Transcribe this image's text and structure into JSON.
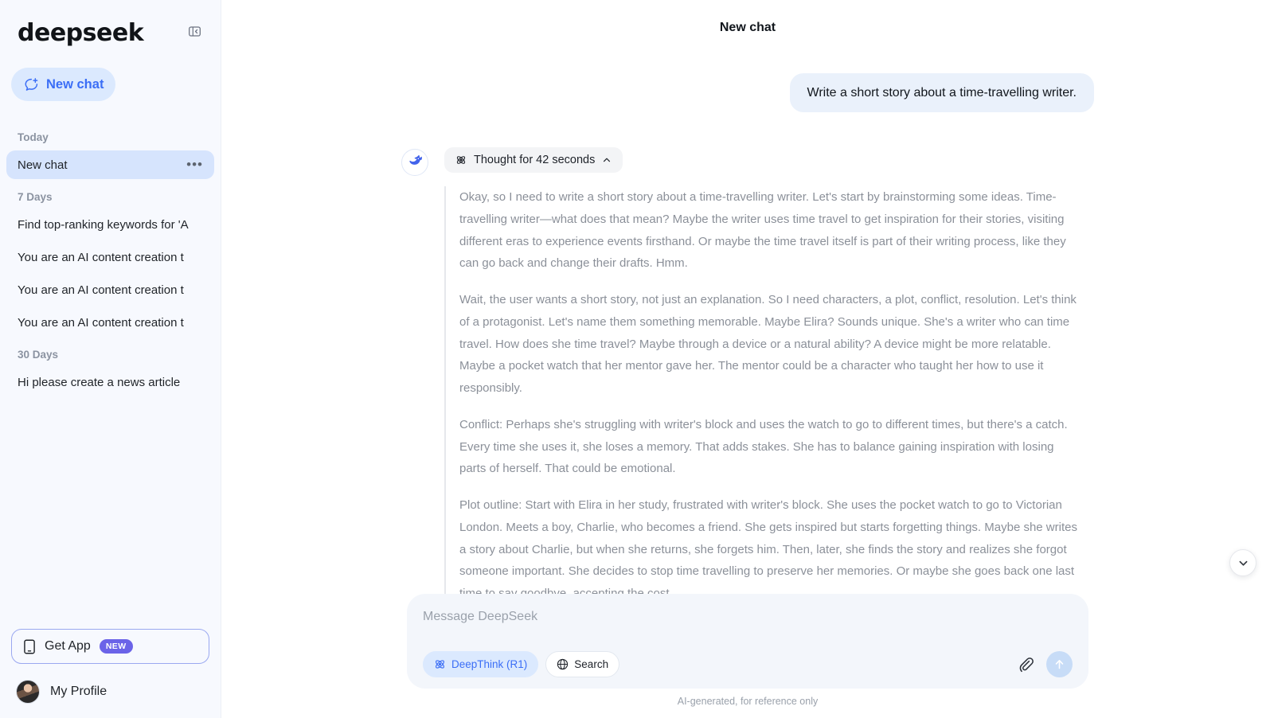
{
  "brand": {
    "name": "deepseek",
    "logo_icon": "deepseek-whale-logo"
  },
  "sidebar": {
    "collapse_icon": "panel-collapse-icon",
    "new_chat": {
      "label": "New chat",
      "icon": "new-chat-plus-icon"
    },
    "groups": [
      {
        "label": "Today",
        "items": [
          {
            "title": "New chat",
            "active": true,
            "menu_icon": "ellipsis-icon"
          }
        ]
      },
      {
        "label": "7 Days",
        "items": [
          {
            "title": "Find top-ranking keywords for 'A",
            "active": false
          },
          {
            "title": "You are an AI content creation t",
            "active": false
          },
          {
            "title": "You are an AI content creation t",
            "active": false
          },
          {
            "title": "You are an AI content creation t",
            "active": false
          }
        ]
      },
      {
        "label": "30 Days",
        "items": [
          {
            "title": "Hi please create a news article",
            "active": false
          }
        ]
      }
    ],
    "get_app": {
      "label": "Get App",
      "badge": "NEW",
      "icon": "mobile-phone-icon"
    },
    "profile": {
      "label": "My Profile",
      "avatar": "user-avatar"
    }
  },
  "header": {
    "title": "New chat"
  },
  "conversation": {
    "user_message": "Write a short story about a time-travelling writer.",
    "assistant": {
      "avatar_icon": "deepseek-whale-avatar",
      "thought_pill": {
        "icon": "atom-thinking-icon",
        "label": "Thought for 42 seconds",
        "chevron": "chevron-up-icon"
      },
      "thinking_paragraphs": [
        "Okay, so I need to write a short story about a time-travelling writer. Let's start by brainstorming some ideas. Time-travelling writer—what does that mean? Maybe the writer uses time travel to get inspiration for their stories, visiting different eras to experience events firsthand. Or maybe the time travel itself is part of their writing process, like they can go back and change their drafts. Hmm.",
        "Wait, the user wants a short story, not just an explanation. So I need characters, a plot, conflict, resolution. Let's think of a protagonist. Let's name them something memorable. Maybe Elira? Sounds unique. She's a writer who can time travel. How does she time travel? Maybe through a device or a natural ability? A device might be more relatable. Maybe a pocket watch that her mentor gave her. The mentor could be a character who taught her how to use it responsibly.",
        "Conflict: Perhaps she's struggling with writer's block and uses the watch to go to different times, but there's a catch. Every time she uses it, she loses a memory. That adds stakes. She has to balance gaining inspiration with losing parts of herself. That could be emotional.",
        "Plot outline: Start with Elira in her study, frustrated with writer's block. She uses the pocket watch to go to Victorian London. Meets a boy, Charlie, who becomes a friend. She gets inspired but starts forgetting things. Maybe she writes a story about Charlie, but when she returns, she forgets him. Then, later, she finds the story and realizes she forgot someone important. She decides to stop time travelling to preserve her memories. Or maybe she goes back one last time to say goodbye, accepting the cost."
      ]
    },
    "scroll_down_icon": "chevron-down-icon"
  },
  "composer": {
    "placeholder": "Message DeepSeek",
    "value": "",
    "tools": [
      {
        "label": "DeepThink (R1)",
        "icon": "atom-icon",
        "active": true
      },
      {
        "label": "Search",
        "icon": "globe-icon",
        "active": false
      }
    ],
    "attach_icon": "paperclip-icon",
    "send_icon": "arrow-up-icon"
  },
  "footer": {
    "note": "AI-generated, for reference only"
  },
  "colors": {
    "accent_blue": "#3b6ef6",
    "sidebar_bg": "#f7f9fe",
    "active_item": "#d6e4fd",
    "user_bubble": "#eaf1fb",
    "badge_purple": "#6b63e8"
  }
}
